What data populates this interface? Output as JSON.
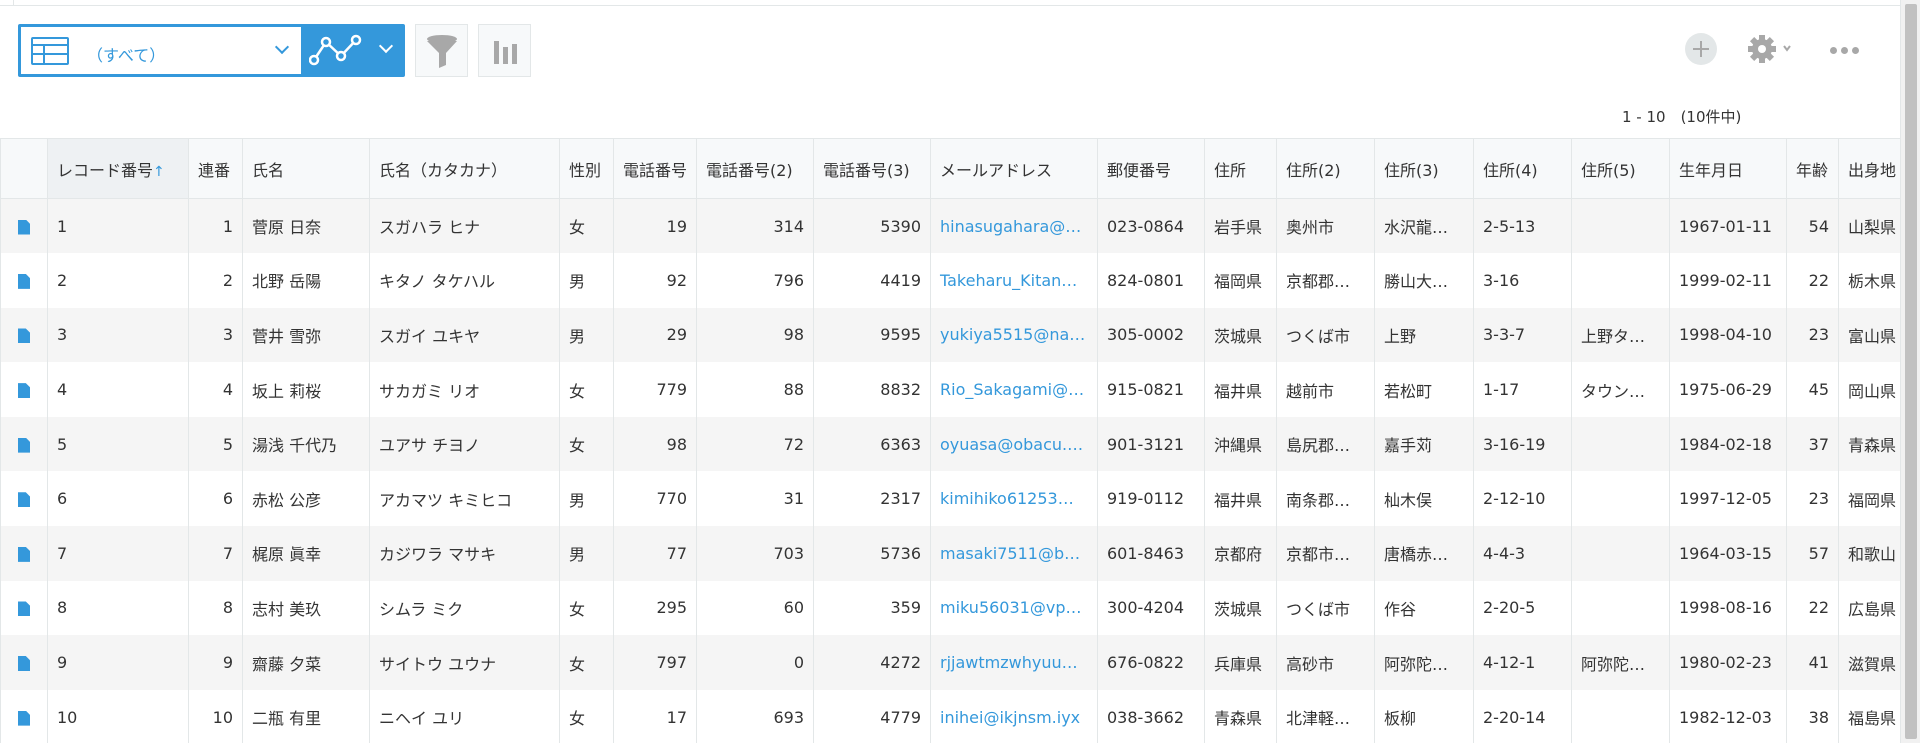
{
  "toolbar": {
    "view_name": "（すべて）",
    "pager": "1 - 10　(10件中)"
  },
  "icons": {
    "view": "table-grid-icon",
    "graph": "line-graph-icon",
    "filter": "funnel-icon",
    "chart": "bar-chart-icon",
    "add": "plus-icon",
    "settings": "gear-icon",
    "more": "ellipsis-icon",
    "record": "document-icon"
  },
  "colors": {
    "accent": "#3498db",
    "row_alt": "#f5f5f5",
    "border": "#e3e7e8",
    "icon_gray": "#a8a8a8"
  },
  "table": {
    "sort_indicator": "↑",
    "columns": [
      "レコード番号",
      "連番",
      "氏名",
      "氏名（カタカナ）",
      "性別",
      "電話番号",
      "電話番号(2)",
      "電話番号(3)",
      "メールアドレス",
      "郵便番号",
      "住所",
      "住所(2)",
      "住所(3)",
      "住所(4)",
      "住所(5)",
      "生年月日",
      "年齢",
      "出身地"
    ],
    "rows": [
      [
        "1",
        "1",
        "菅原 日奈",
        "スガハラ ヒナ",
        "女",
        "19",
        "314",
        "5390",
        "hinasugahara@…",
        "023-0864",
        "岩手県",
        "奥州市",
        "水沢龍…",
        "2-5-13",
        "",
        "1967-01-11",
        "54",
        "山梨県"
      ],
      [
        "2",
        "2",
        "北野 岳陽",
        "キタノ タケハル",
        "男",
        "92",
        "796",
        "4419",
        "Takeharu_Kitan…",
        "824-0801",
        "福岡県",
        "京都郡…",
        "勝山大…",
        "3-16",
        "",
        "1999-02-11",
        "22",
        "栃木県"
      ],
      [
        "3",
        "3",
        "菅井 雪弥",
        "スガイ ユキヤ",
        "男",
        "29",
        "98",
        "9595",
        "yukiya5515@na…",
        "305-0002",
        "茨城県",
        "つくば市",
        "上野",
        "3-3-7",
        "上野タ…",
        "1998-04-10",
        "23",
        "富山県"
      ],
      [
        "4",
        "4",
        "坂上 莉桜",
        "サカガミ リオ",
        "女",
        "779",
        "88",
        "8832",
        "Rio_Sakagami@…",
        "915-0821",
        "福井県",
        "越前市",
        "若松町",
        "1-17",
        "タウン…",
        "1975-06-29",
        "45",
        "岡山県"
      ],
      [
        "5",
        "5",
        "湯浅 千代乃",
        "ユアサ チヨノ",
        "女",
        "98",
        "72",
        "6363",
        "oyuasa@obacu.…",
        "901-3121",
        "沖縄県",
        "島尻郡…",
        "嘉手苅",
        "3-16-19",
        "",
        "1984-02-18",
        "37",
        "青森県"
      ],
      [
        "6",
        "6",
        "赤松 公彦",
        "アカマツ キミヒコ",
        "男",
        "770",
        "31",
        "2317",
        "kimihiko61253…",
        "919-0112",
        "福井県",
        "南条郡…",
        "杣木俣",
        "2-12-10",
        "",
        "1997-12-05",
        "23",
        "福岡県"
      ],
      [
        "7",
        "7",
        "梶原 眞幸",
        "カジワラ マサキ",
        "男",
        "77",
        "703",
        "5736",
        "masaki7511@b…",
        "601-8463",
        "京都府",
        "京都市…",
        "唐橋赤…",
        "4-4-3",
        "",
        "1964-03-15",
        "57",
        "和歌山"
      ],
      [
        "8",
        "8",
        "志村 美玖",
        "シムラ ミク",
        "女",
        "295",
        "60",
        "359",
        "miku56031@vp…",
        "300-4204",
        "茨城県",
        "つくば市",
        "作谷",
        "2-20-5",
        "",
        "1998-08-16",
        "22",
        "広島県"
      ],
      [
        "9",
        "9",
        "齋藤 夕菜",
        "サイトウ ユウナ",
        "女",
        "797",
        "0",
        "4272",
        "rjjawtmzwhyuu…",
        "676-0822",
        "兵庫県",
        "高砂市",
        "阿弥陀…",
        "4-12-1",
        "阿弥陀…",
        "1980-02-23",
        "41",
        "滋賀県"
      ],
      [
        "10",
        "10",
        "二瓶 有里",
        "ニヘイ ユリ",
        "女",
        "17",
        "693",
        "4779",
        "inihei@ikjnsm.iyx",
        "038-3662",
        "青森県",
        "北津軽…",
        "板柳",
        "2-20-14",
        "",
        "1982-12-03",
        "38",
        "福島県"
      ]
    ]
  }
}
